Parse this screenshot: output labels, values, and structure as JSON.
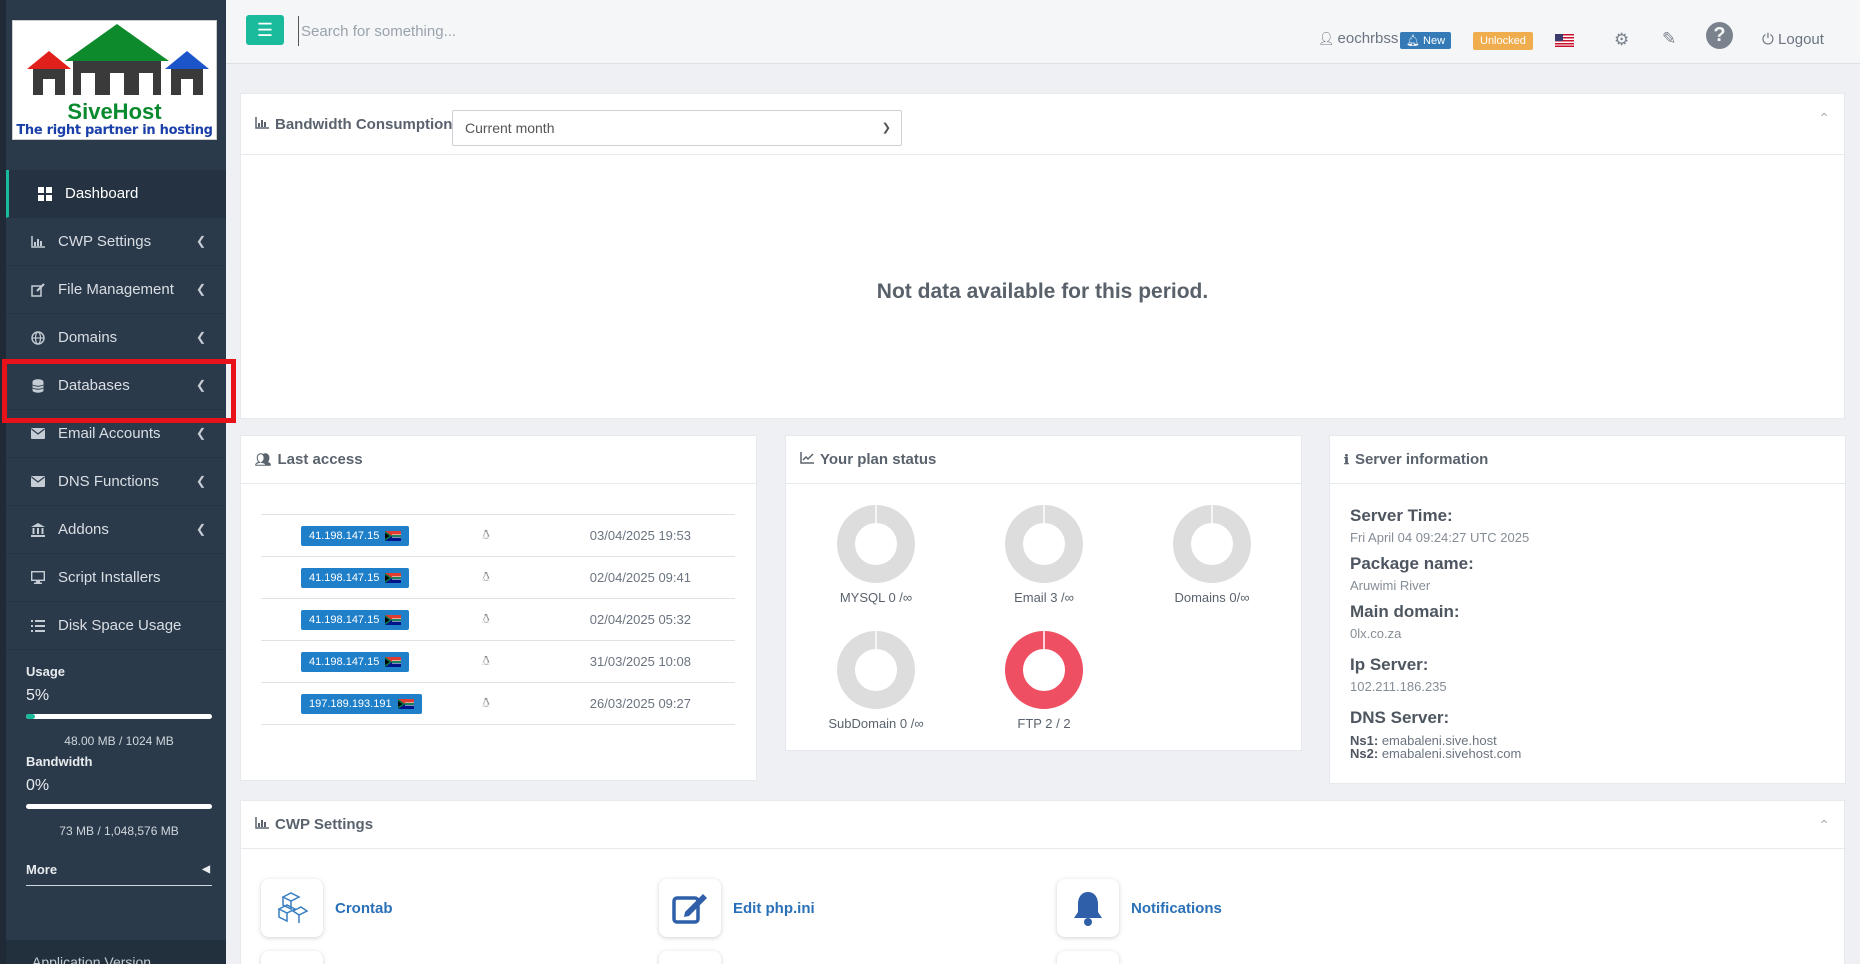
{
  "app": {
    "brand": "SiveHost",
    "tagline": "The right partner in hosting"
  },
  "sidebar": {
    "items": [
      {
        "label": "Dashboard",
        "icon": "dashboard-icon",
        "active": true
      },
      {
        "label": "CWP Settings",
        "icon": "bar-chart-icon"
      },
      {
        "label": "File Management",
        "icon": "edit-icon"
      },
      {
        "label": "Domains",
        "icon": "globe-icon"
      },
      {
        "label": "Databases",
        "icon": "database-icon",
        "highlighted": true
      },
      {
        "label": "Email Accounts",
        "icon": "envelope-icon"
      },
      {
        "label": "DNS Functions",
        "icon": "envelope-icon"
      },
      {
        "label": "Addons",
        "icon": "bank-icon"
      },
      {
        "label": "Script Installers",
        "icon": "monitor-icon"
      },
      {
        "label": "Disk Space Usage",
        "icon": "list-icon"
      }
    ],
    "usage": {
      "label": "Usage",
      "percent": "5%",
      "fill_fraction": 0.05,
      "amount": "48.00 MB / 1024 MB"
    },
    "bandwidth": {
      "label": "Bandwidth",
      "percent": "0%",
      "fill_fraction": 0.0,
      "amount": "73 MB / 1,048,576 MB"
    },
    "more_label": "More",
    "app_version_label": "Application Version"
  },
  "topbar": {
    "search_placeholder": "Search for something...",
    "username": "eochrbss",
    "new_badge": "New",
    "unlocked_badge": "Unlocked",
    "logout_label": "Logout"
  },
  "bandwidth_panel": {
    "title": "Bandwidth Consumption",
    "period_selected": "Current month",
    "empty_message": "Not data available for this period."
  },
  "last_access": {
    "title": "Last access",
    "rows": [
      {
        "ip": "41.198.147.15",
        "date": "03/04/2025 19:53"
      },
      {
        "ip": "41.198.147.15",
        "date": "02/04/2025 09:41"
      },
      {
        "ip": "41.198.147.15",
        "date": "02/04/2025 05:32"
      },
      {
        "ip": "41.198.147.15",
        "date": "31/03/2025 10:08"
      },
      {
        "ip": "197.189.193.191",
        "date": "26/03/2025 09:27"
      }
    ]
  },
  "plan_status": {
    "title": "Your plan status",
    "items": [
      {
        "label": "MYSQL 0 /∞",
        "used_fraction": 0.0,
        "color": "#dddddd"
      },
      {
        "label": "Email 3 /∞",
        "used_fraction": 0.0,
        "color": "#dddddd"
      },
      {
        "label": "Domains 0/∞",
        "used_fraction": 0.0,
        "color": "#dddddd"
      },
      {
        "label": "SubDomain 0 /∞",
        "used_fraction": 0.0,
        "color": "#dddddd"
      },
      {
        "label": "FTP 2 / 2",
        "used_fraction": 1.0,
        "color": "#ee4f62"
      }
    ]
  },
  "server_info": {
    "title": "Server information",
    "server_time_label": "Server Time:",
    "server_time": "Fri April 04 09:24:27 UTC 2025",
    "package_label": "Package name:",
    "package": "Aruwimi River",
    "main_domain_label": "Main domain:",
    "main_domain": "0lx.co.za",
    "ip_label": "Ip Server:",
    "ip": "102.211.186.235",
    "dns_label": "DNS Server:",
    "ns1_label": "Ns1:",
    "ns1": "emabaleni.sive.host",
    "ns2_label": "Ns2:",
    "ns2": "emabaleni.sivehost.com"
  },
  "cwp_settings": {
    "title": "CWP Settings",
    "shortcuts": [
      {
        "label": "Crontab",
        "icon": "crontab-icon"
      },
      {
        "label": "Edit php.ini",
        "icon": "edit-icon"
      },
      {
        "label": "Notifications",
        "icon": "bell-icon"
      }
    ]
  },
  "colors": {
    "accent": "#1abb9c",
    "sidebar": "#2b3a4a",
    "link": "#2a70b8",
    "ip_badge": "#1f7fc9",
    "highlight_box": "#e8121a"
  }
}
